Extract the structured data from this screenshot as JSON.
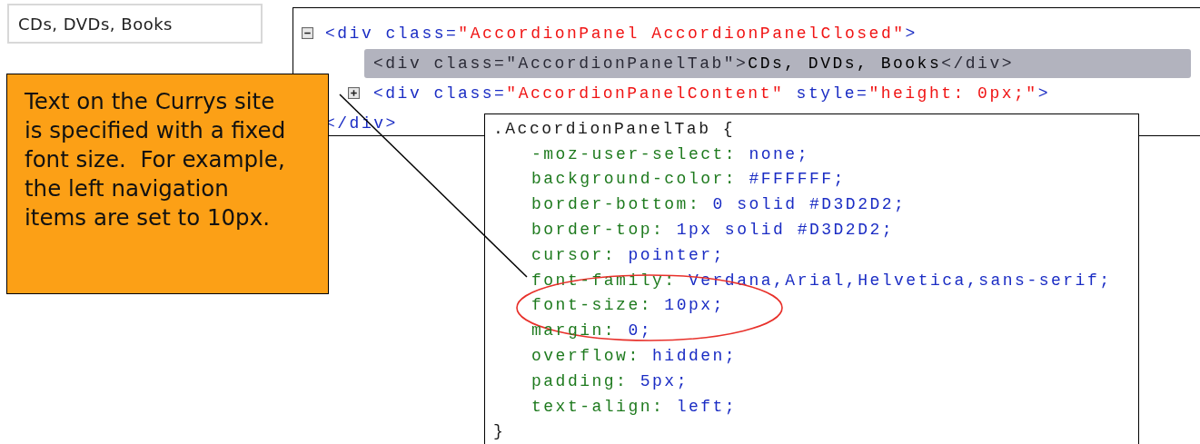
{
  "nav_item": {
    "label": "CDs, DVDs, Books"
  },
  "dom_tree": [
    {
      "kind": "element",
      "expanded": true,
      "tokens": [
        {
          "kind": "tag",
          "text": "<div class="
        },
        {
          "kind": "value",
          "text": "\"AccordionPanel AccordionPanelClosed\""
        },
        {
          "kind": "tag",
          "text": ">"
        }
      ],
      "children": [
        {
          "kind": "leaf",
          "selected": true,
          "tokens": [
            {
              "kind": "tag",
              "text": "<div class=\"AccordionPanelTab\">"
            },
            {
              "kind": "text",
              "text": "CDs, DVDs, Books"
            },
            {
              "kind": "tag",
              "text": "</div>"
            }
          ]
        },
        {
          "kind": "element",
          "expanded": false,
          "tokens": [
            {
              "kind": "tag",
              "text": "<div class="
            },
            {
              "kind": "value",
              "text": "\"AccordionPanelContent\""
            },
            {
              "kind": "tag",
              "text": " style="
            },
            {
              "kind": "value",
              "text": "\"height: 0px;\""
            },
            {
              "kind": "tag",
              "text": ">"
            }
          ]
        }
      ],
      "close_tag": "</div>"
    }
  ],
  "callout": {
    "text": "Text on the Currys site is specified with a fixed font size.  For example, the left navigation items are set to 10px."
  },
  "css_rule": {
    "selector": ".AccordionPanelTab {",
    "declarations": [
      {
        "property": "-moz-user-select:",
        "value": "none;",
        "highlighted": false
      },
      {
        "property": "background-color:",
        "value": "#FFFFFF;",
        "highlighted": false
      },
      {
        "property": "border-bottom:",
        "value": "0 solid #D3D2D2;",
        "highlighted": false
      },
      {
        "property": "border-top:",
        "value": "1px solid #D3D2D2;",
        "highlighted": false
      },
      {
        "property": "cursor:",
        "value": "pointer;",
        "highlighted": false
      },
      {
        "property": "font-family:",
        "value": "Verdana,Arial,Helvetica,sans-serif;",
        "highlighted": false
      },
      {
        "property": "font-size:",
        "value": "10px;",
        "highlighted": true
      },
      {
        "property": "margin:",
        "value": "0;",
        "highlighted": false
      },
      {
        "property": "overflow:",
        "value": "hidden;",
        "highlighted": false
      },
      {
        "property": "padding:",
        "value": "5px;",
        "highlighted": false
      },
      {
        "property": "text-align:",
        "value": "left;",
        "highlighted": false
      }
    ],
    "close": "}"
  }
}
